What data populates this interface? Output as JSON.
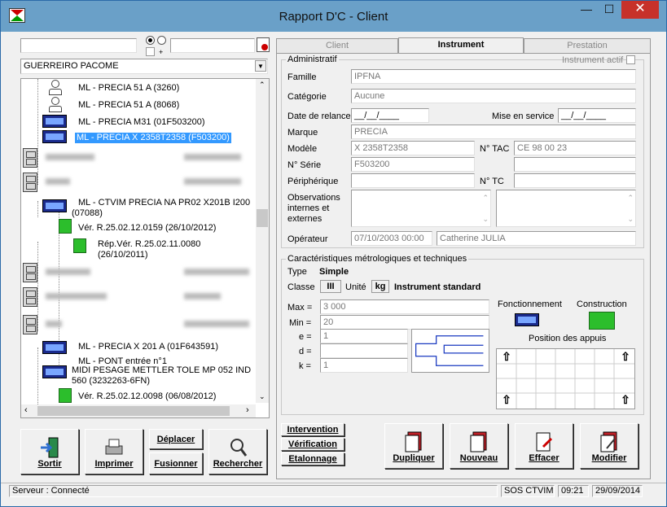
{
  "window": {
    "title": "Rapport D'C - Client",
    "min": "—",
    "max": "☐",
    "close": "✕"
  },
  "left": {
    "search_value": "",
    "search2_value": "",
    "client_select": "GUERREIRO PACOME",
    "tree": [
      {
        "label": "ML - PRECIA 51 A (3260)",
        "icon": "scale-icon"
      },
      {
        "label": "ML - PRECIA 51 A (8068)",
        "icon": "scale-icon"
      },
      {
        "label": "ML - PRECIA M31 (01F503200)",
        "icon": "display-icon"
      },
      {
        "label": "ML - PRECIA X 2358T2358 (F503200)",
        "icon": "display-icon",
        "selected": true
      },
      {
        "label": "ML - CTVIM PRECIA NA PR02 X201B I200",
        "label2": "(07088)",
        "icon": "display-icon"
      },
      {
        "label": "Vér. R.25.02.12.0159 (26/10/2012)",
        "icon": "check-icon"
      },
      {
        "label": "Rép.Vér. R.25.02.11.0080",
        "label2": "(26/10/2011)",
        "icon": "repair-icon"
      },
      {
        "label": "ML - PRECIA X 201 A (01F643591)",
        "icon": "display-icon"
      },
      {
        "label": "ML - PONT entrée n°1",
        "icon": "scale-icon"
      },
      {
        "label": "MIDI PESAGE METTLER TOLE MP 052 IND",
        "label2": "560 (3232263-6FN)",
        "icon": "display-icon"
      },
      {
        "label": "Vér. R.25.02.12.0098 (06/08/2012)",
        "icon": "check-icon"
      }
    ],
    "buttons": {
      "sortir": "Sortir",
      "imprimer": "Imprimer",
      "deplacer": "Déplacer",
      "fusionner": "Fusionner",
      "rechercher": "Rechercher"
    }
  },
  "tabs": [
    "Client",
    "Instrument",
    "Prestation"
  ],
  "admin": {
    "title": "Administratif",
    "instrument_actif": "Instrument actif",
    "famille_label": "Famille",
    "famille": "IPFNA",
    "categorie_label": "Catégorie",
    "categorie": "Aucune",
    "relance_label": "Date de relance",
    "relance": "__/__/____",
    "mise_label": "Mise en service",
    "mise": "__/__/____",
    "marque_label": "Marque",
    "marque": "PRECIA",
    "modele_label": "Modèle",
    "modele": "X 2358T2358",
    "tac_label": "N° TAC",
    "tac": "CE 98 00 23",
    "serie_label": "N° Série",
    "serie": "F503200",
    "peripherique_label": "Périphérique",
    "peripherique": "",
    "tc_label": "N° TC",
    "tc": "",
    "obs_label1": "Observations",
    "obs_label2": "internes et",
    "obs_label3": "externes",
    "operateur_label": "Opérateur",
    "operateur_date": "07/10/2003 00:00",
    "operateur_name": "Catherine JULIA"
  },
  "tech": {
    "title": "Caractéristiques métrologiques et techniques",
    "type_label": "Type",
    "type": "Simple",
    "classe_label": "Classe",
    "classe": "III",
    "unite_label": "Unité",
    "unite": "kg",
    "instrument": "Instrument standard",
    "max_label": "Max =",
    "max": "3 000",
    "min_label": "Min =",
    "min": "20",
    "e_label": "e =",
    "e": "1",
    "d_label": "d =",
    "d": "",
    "k_label": "k =",
    "k": "1",
    "fonctionnement": "Fonctionnement",
    "construction": "Construction",
    "appuis": "Position des appuis",
    "arrow": "⇧"
  },
  "actions": {
    "intervention": "Intervention",
    "verification": "Vérification",
    "etalonnage": "Etalonnage",
    "dupliquer": "Dupliquer",
    "nouveau": "Nouveau",
    "effacer": "Effacer",
    "modifier": "Modifier"
  },
  "status": {
    "server": "Serveur : Connecté",
    "company": "SOS CTVIM",
    "time": "09:21",
    "date": "29/09/2014"
  }
}
